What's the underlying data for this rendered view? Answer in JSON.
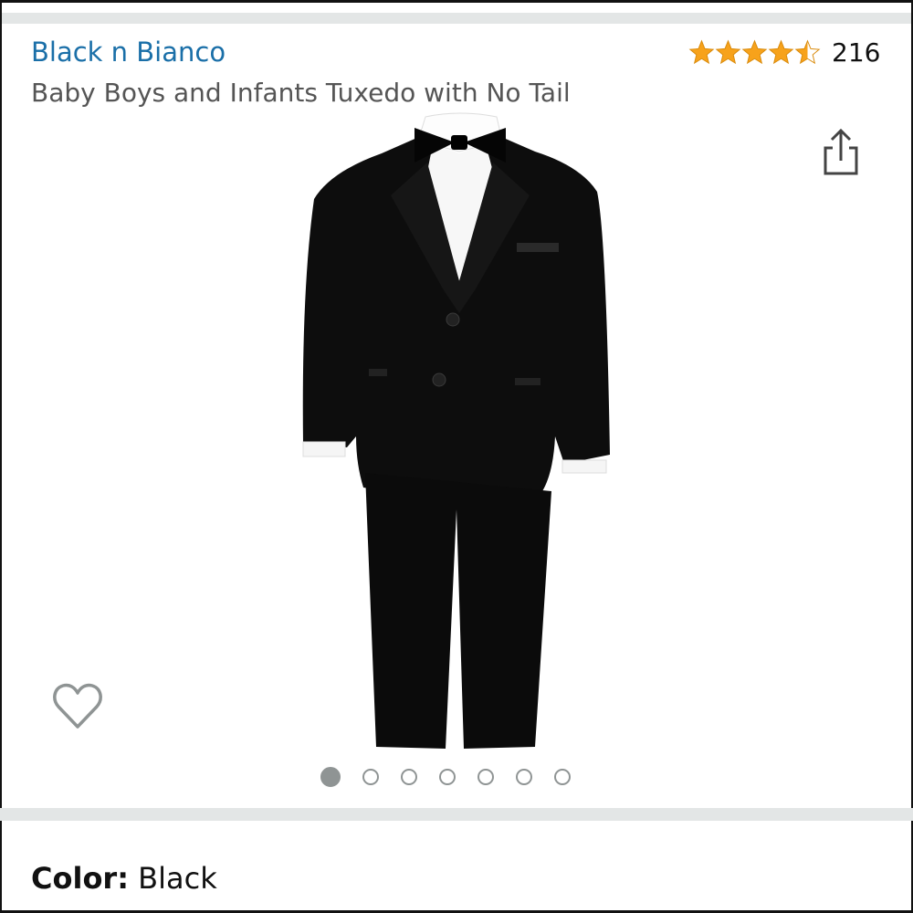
{
  "product": {
    "brand": "Black n Bianco",
    "title": "Baby Boys and Infants Tuxedo with No Tail",
    "rating_value": 4.5,
    "review_count": "216"
  },
  "carousel": {
    "image_description": "black tuxedo with white shirt and bow tie",
    "total_images": 7,
    "active_index": 0
  },
  "icons": {
    "share": "share-icon",
    "wishlist": "heart-outline-icon",
    "star": "star-icon"
  },
  "colors": {
    "brand_link": "#1a6fa8",
    "star": "#f7a21b",
    "muted_text": "#555555",
    "dot": "#8f9494",
    "band": "#e3e6e6"
  },
  "color_selector": {
    "label": "Color:",
    "value": "Black"
  }
}
